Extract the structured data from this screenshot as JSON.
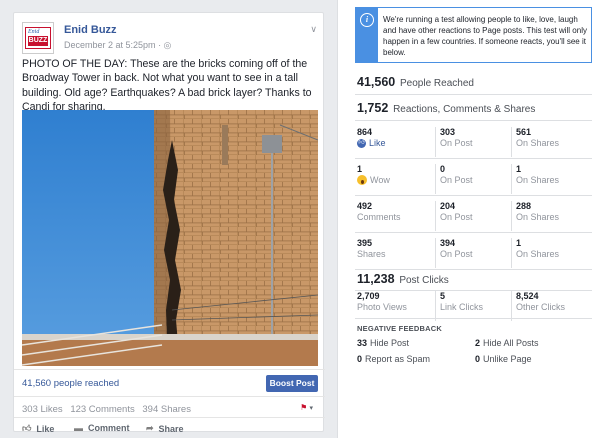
{
  "post": {
    "page_name": "Enid Buzz",
    "timestamp": "December 2 at 5:25pm",
    "audience_icon": "globe-icon",
    "text": "PHOTO OF THE DAY: These are the bricks coming off of the Broadway Tower in back. Not what you want to see in a tall building. Old age? Earthquakes? A bad brick layer? Thanks to Candi for sharing.",
    "reach_label": "41,560 people reached",
    "boost_label": "Boost Post",
    "likes": "303 Likes",
    "comments": "123 Comments",
    "shares": "394 Shares",
    "actions": {
      "like": "Like",
      "comment": "Comment",
      "share": "Share"
    }
  },
  "insights": {
    "notice": "We're running a test allowing people to like, love, laugh and have other reactions to Page posts. This test will only happen in a few countries. If someone reacts, you'll see it below.",
    "people_reached": {
      "value": "41,560",
      "label": "People Reached"
    },
    "reactions_total": {
      "value": "1,752",
      "label": "Reactions, Comments & Shares"
    },
    "grid": [
      [
        {
          "v": "864",
          "l": "Like",
          "icon": "like"
        },
        {
          "v": "303",
          "l": "On Post"
        },
        {
          "v": "561",
          "l": "On Shares"
        }
      ],
      [
        {
          "v": "1",
          "l": "Wow",
          "icon": "wow"
        },
        {
          "v": "0",
          "l": "On Post"
        },
        {
          "v": "1",
          "l": "On Shares"
        }
      ],
      [
        {
          "v": "492",
          "l": "Comments"
        },
        {
          "v": "204",
          "l": "On Post"
        },
        {
          "v": "288",
          "l": "On Shares"
        }
      ],
      [
        {
          "v": "395",
          "l": "Shares"
        },
        {
          "v": "394",
          "l": "On Post"
        },
        {
          "v": "1",
          "l": "On Shares"
        }
      ]
    ],
    "post_clicks": {
      "value": "11,238",
      "label": "Post Clicks"
    },
    "clicks": [
      {
        "v": "2,709",
        "l": "Photo Views"
      },
      {
        "v": "5",
        "l": "Link Clicks"
      },
      {
        "v": "8,524",
        "l": "Other Clicks"
      }
    ],
    "negative_title": "NEGATIVE FEEDBACK",
    "negative": [
      {
        "v": "33",
        "l": "Hide Post"
      },
      {
        "v": "2",
        "l": "Hide All Posts"
      },
      {
        "v": "0",
        "l": "Report as Spam"
      },
      {
        "v": "0",
        "l": "Unlike Page"
      }
    ]
  },
  "colors": {
    "accent": "#4267b2",
    "link": "#365899",
    "notice": "#4a90e2"
  }
}
